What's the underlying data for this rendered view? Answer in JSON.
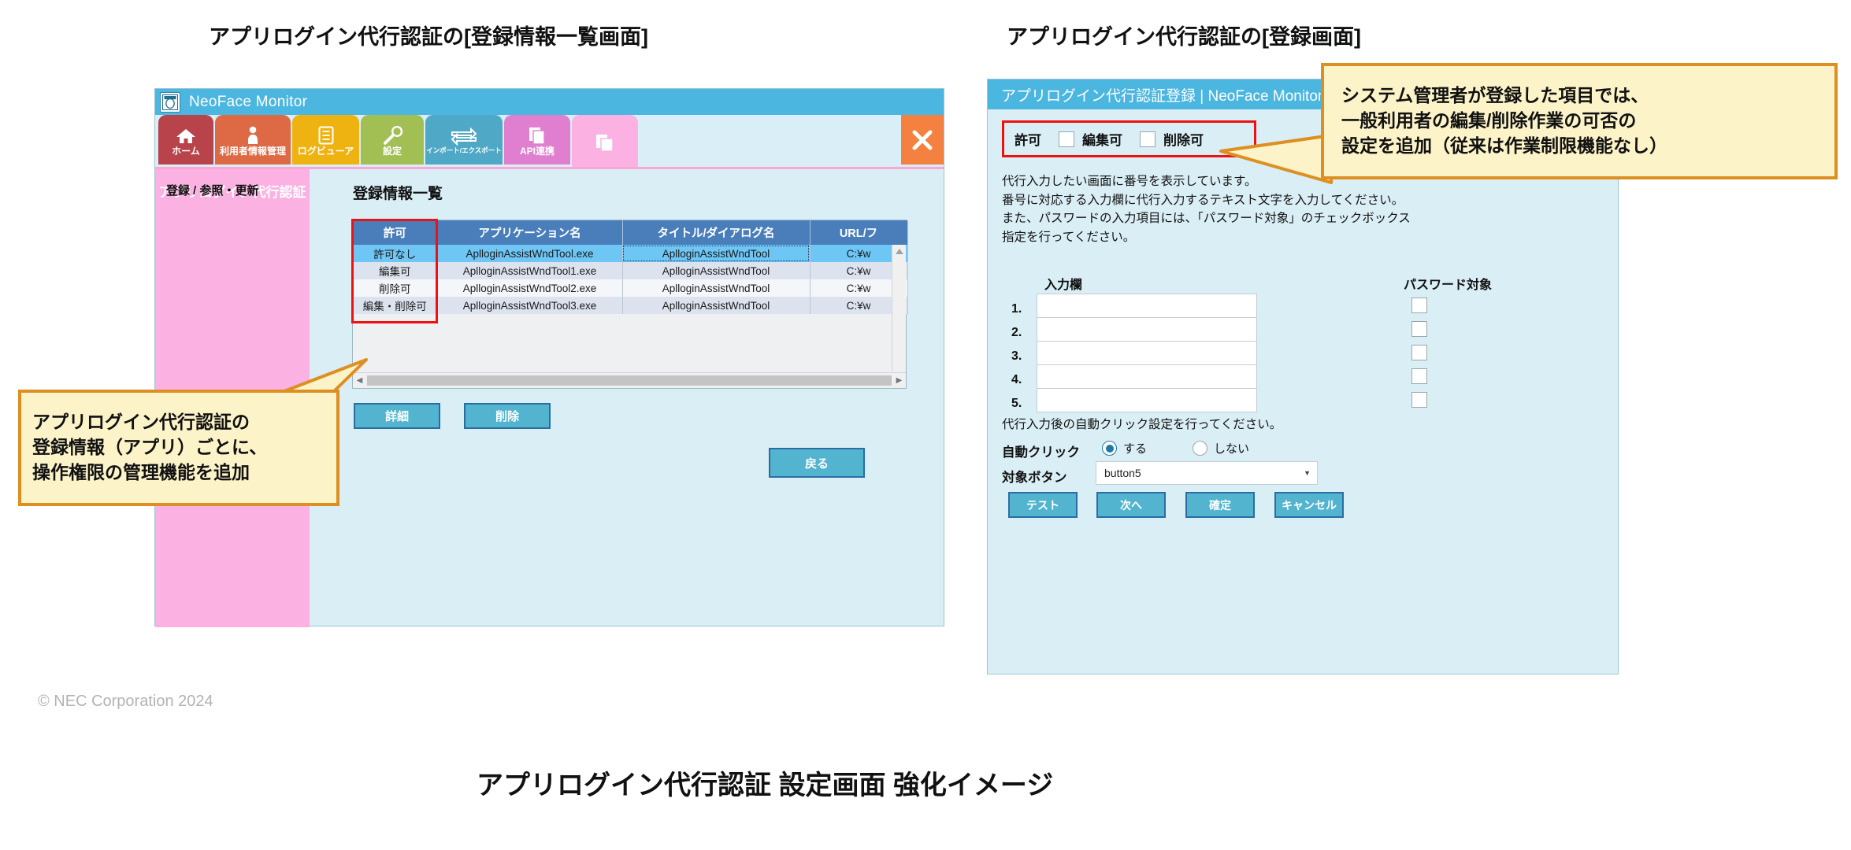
{
  "headings": {
    "left_title": "アプリログイン代行認証の[登録情報一覧画面]",
    "right_title": "アプリログイン代行認証の[登録画面]",
    "bottom_caption": "アプリログイン代行認証 設定画面 強化イメージ",
    "copyright": "© NEC Corporation 2024"
  },
  "left_window": {
    "titlebar": {
      "app_title": "NeoFace Monitor",
      "logo_text": "NeoFace Monitor"
    },
    "tabs": [
      {
        "label": "ホーム",
        "icon": "home-icon",
        "color": "#b8434a"
      },
      {
        "label": "利用者情報管理",
        "icon": "person-icon",
        "color": "#dd6a45"
      },
      {
        "label": "ログビューア",
        "icon": "document-icon",
        "color": "#eeb211"
      },
      {
        "label": "設定",
        "icon": "wrench-icon",
        "color": "#a2bf54"
      },
      {
        "label": "インポート/エクスポート",
        "icon": "import-export-icon",
        "color": "#4fa9c6"
      },
      {
        "label": "API連携",
        "icon": "api-pages-icon",
        "color": "#e07fd0"
      },
      {
        "label": "",
        "icon": "pages-icon",
        "color": "#fbb1e2"
      }
    ],
    "close_label": "✕",
    "breadcrumb": "アプリログイン代行認証",
    "sidebar_label": "登録 / 参照・更新",
    "panel_title": "登録情報一覧",
    "table": {
      "columns": [
        "許可",
        "アプリケーション名",
        "タイトル/ダイアログ名",
        "URL/フ"
      ],
      "rows": [
        {
          "permission": "許可なし",
          "app": "AplloginAssistWndTool.exe",
          "title": "AplloginAssistWndTool",
          "url": "C:¥w"
        },
        {
          "permission": "編集可",
          "app": "AplloginAssistWndTool1.exe",
          "title": "AplloginAssistWndTool",
          "url": "C:¥w"
        },
        {
          "permission": "削除可",
          "app": "AplloginAssistWndTool2.exe",
          "title": "AplloginAssistWndTool",
          "url": "C:¥w"
        },
        {
          "permission": "編集・削除可",
          "app": "AplloginAssistWndTool3.exe",
          "title": "AplloginAssistWndTool",
          "url": "C:¥w"
        }
      ]
    },
    "buttons": {
      "detail": "詳細",
      "delete": "削除",
      "back": "戻る"
    }
  },
  "right_window": {
    "titlebar": "アプリログイン代行認証登録 | NeoFace Monitor",
    "permission": {
      "label": "許可",
      "edit_label": "編集可",
      "delete_label": "削除可",
      "edit_checked": false,
      "delete_checked": false
    },
    "instructions": [
      "代行入力したい画面に番号を表示しています。",
      "番号に対応する入力欄に代行入力するテキスト文字を入力してください。",
      "また、パスワードの入力項目には、「パスワード対象」のチェックボックス",
      "指定を行ってください。"
    ],
    "column_headers": {
      "input": "入力欄",
      "password": "パスワード対象"
    },
    "input_rows": [
      {
        "num": "1.",
        "value": "",
        "password_checked": false
      },
      {
        "num": "2.",
        "value": "",
        "password_checked": false
      },
      {
        "num": "3.",
        "value": "",
        "password_checked": false
      },
      {
        "num": "4.",
        "value": "",
        "password_checked": false
      },
      {
        "num": "5.",
        "value": "",
        "password_checked": false
      }
    ],
    "autoclick": {
      "note": "代行入力後の自動クリック設定を行ってください。",
      "label": "自動クリック",
      "option_yes": "する",
      "option_no": "しない",
      "selected": "する",
      "target_label": "対象ボタン",
      "target_value": "button5"
    },
    "buttons": {
      "test": "テスト",
      "next": "次へ",
      "confirm": "確定",
      "cancel": "キャンセル"
    }
  },
  "callouts": {
    "left": {
      "lines": [
        "アプリログイン代行認証の",
        "登録情報（アプリ）ごとに、",
        "操作権限の管理機能を追加"
      ]
    },
    "right": {
      "lines": [
        "システム管理者が登録した項目では、",
        "一般利用者の編集/削除作業の可否の",
        "設定を追加（従来は作業制限機能なし）"
      ]
    }
  }
}
